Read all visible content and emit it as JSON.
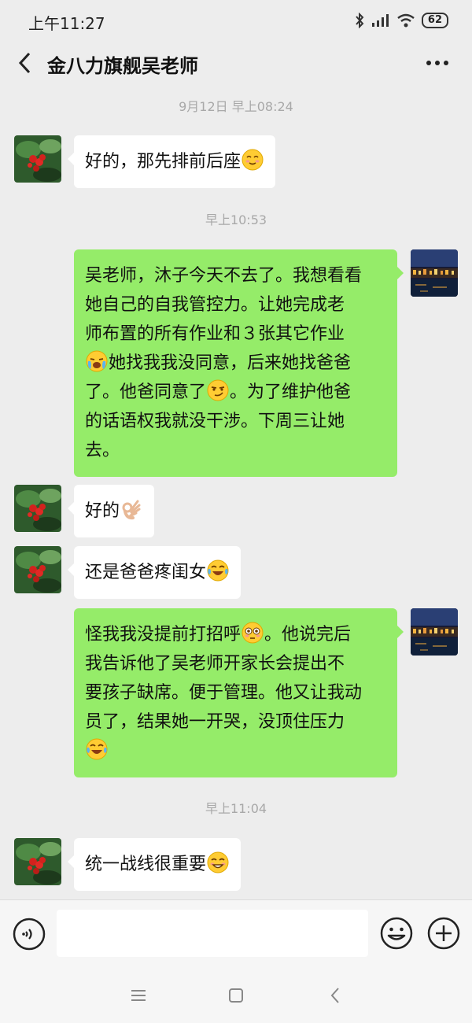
{
  "status_bar": {
    "time": "上午11:27",
    "battery": "62"
  },
  "header": {
    "title": "金八力旗舰吴老师"
  },
  "timestamps": [
    "9月12日 早上08:24",
    "早上10:53",
    "早上11:04"
  ],
  "messages": [
    {
      "side": "in",
      "lines": [
        "好的，那先排前后座"
      ]
    },
    {
      "side": "out",
      "lines": [
        "吴老师，沐子今天不去了。我想看看",
        "她自己的自我管控力。让她完成老",
        "师布置的所有作业和３张其它作业",
        "她找我我没同意，后来她找爸爸",
        "了。他爸同意了",
        "。为了维护他爸",
        "的话语权我就没干涉。下周三让她",
        "去。"
      ]
    },
    {
      "side": "in",
      "lines": [
        "好的"
      ]
    },
    {
      "side": "in",
      "lines": [
        "还是爸爸疼闺女"
      ]
    },
    {
      "side": "out",
      "lines": [
        "怪我我没提前打招呼",
        "。他说完后",
        "我告诉他了吴老师开家长会提出不",
        "要孩子缺席。便于管理。他又让我动",
        "员了，结果她一开哭，没顶住压力"
      ]
    },
    {
      "side": "in",
      "lines": [
        "统一战线很重要"
      ]
    }
  ],
  "icons": {
    "back": "back-arrow-icon",
    "more": "more-dots-icon",
    "voice": "voice-icon",
    "emoji": "emoji-icon",
    "plus": "plus-icon"
  },
  "colors": {
    "background": "#ededed",
    "bubble_in": "#ffffff",
    "bubble_out": "#95ec69",
    "timestamp": "#a8a8a8"
  }
}
